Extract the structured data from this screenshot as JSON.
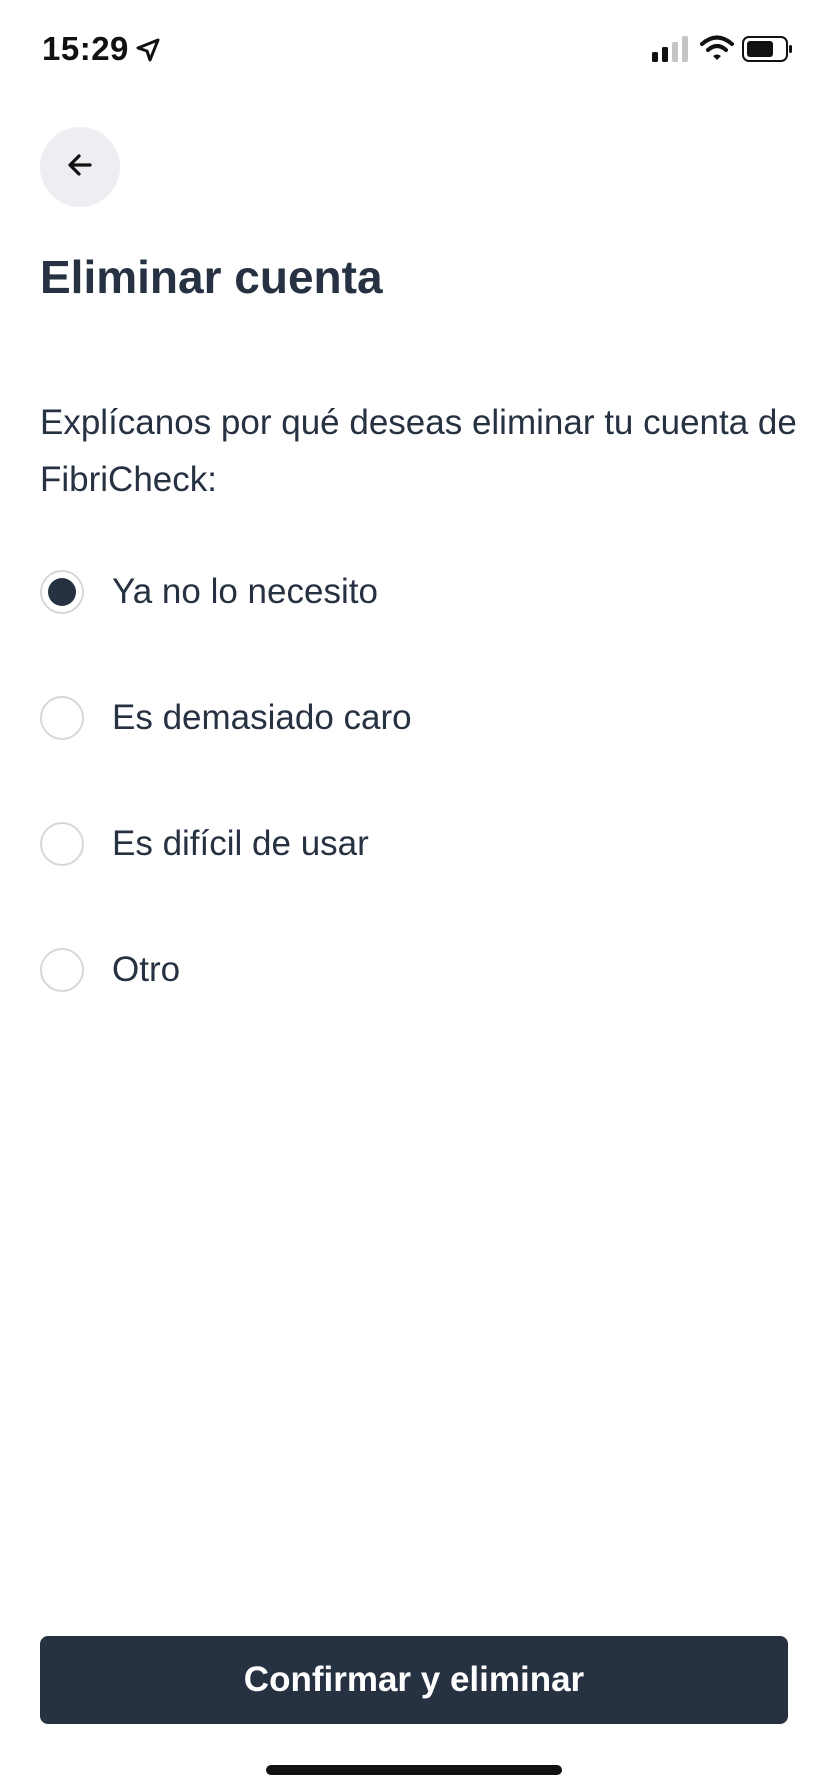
{
  "status_bar": {
    "time": "15:29",
    "icons": [
      "location-arrow-icon",
      "cellular-signal-icon",
      "wifi-icon",
      "battery-icon"
    ]
  },
  "header": {
    "back_icon": "arrow-left-icon",
    "title": "Eliminar cuenta"
  },
  "main": {
    "prompt": "Explícanos por qué deseas eliminar tu cuenta de FibriCheck:",
    "options": [
      {
        "label": "Ya no lo necesito",
        "selected": true
      },
      {
        "label": "Es demasiado caro",
        "selected": false
      },
      {
        "label": "Es difícil de usar",
        "selected": false
      },
      {
        "label": "Otro",
        "selected": false
      }
    ]
  },
  "footer": {
    "confirm_label": "Confirmar y eliminar"
  },
  "colors": {
    "primary": "#263142",
    "back_button_bg": "#eceef1",
    "radio_border": "#d4d7dc",
    "background": "#ffffff"
  }
}
